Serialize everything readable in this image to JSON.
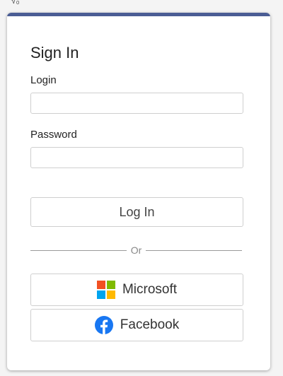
{
  "corner_text": "√₀",
  "card": {
    "title": "Sign In",
    "login_label": "Login",
    "login_value": "",
    "password_label": "Password",
    "password_value": "",
    "login_button": "Log In",
    "divider_text": "Or",
    "microsoft_button": "Microsoft",
    "facebook_button": "Facebook"
  },
  "colors": {
    "accent_bar": "#4a5d94",
    "microsoft_red": "#f25022",
    "microsoft_green": "#7fba00",
    "microsoft_blue": "#00a4ef",
    "microsoft_yellow": "#ffb900",
    "facebook_blue": "#1877f2"
  },
  "icons": {
    "microsoft": "microsoft-logo-icon",
    "facebook": "facebook-logo-icon"
  }
}
